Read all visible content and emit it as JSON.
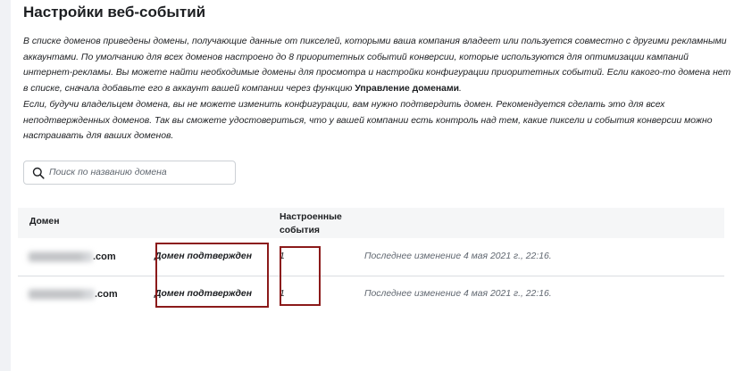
{
  "page": {
    "title": "Настройки веб-событий"
  },
  "intro": {
    "para1_text": "В списке доменов приведены домены, получающие данные от пикселей, которыми ваша компания владеет или пользуется совместно с другими рекламными аккаунтами. По умолчанию для всех доменов настроено до 8 приоритетных событий конверсии, которые используются для оптимизации кампаний интернет-рекламы. Вы можете найти необходимые домены для просмотра и настройки конфигурации приоритетных событий. Если какого-то домена нет в списке, сначала добавьте его в аккаунт вашей компании через функцию ",
    "para1_link": "Управление доменами",
    "para1_end": ".",
    "para2_text": "Если, будучи владельцем домена, вы не можете изменить конфигурации, вам нужно подтвердить домен. Рекомендуется сделать это для всех неподтвержденных доменов. Так вы сможете удостовериться, что у вашей компании есть контроль над тем, какие пиксели и события конверсии можно настраивать для ваших доменов."
  },
  "search": {
    "placeholder": "Поиск по названию домена",
    "icon": "search-icon"
  },
  "table": {
    "headers": {
      "domain": "Домен",
      "events_line1": "Настроенные",
      "events_line2": "события"
    },
    "rows": [
      {
        "domain_suffix": ".com",
        "status": "Домен подтвержден",
        "events": "1",
        "modified": "Последнее изменение 4 мая 2021 г., 22:16."
      },
      {
        "domain_suffix": ".com",
        "status": "Домен подтвержден",
        "events": "1",
        "modified": "Последнее изменение 4 мая 2021 г., 22:16."
      }
    ]
  },
  "colors": {
    "highlight_border": "#8b1a1a",
    "header_bg": "#f5f6f7",
    "page_bg": "#f0f2f5"
  }
}
